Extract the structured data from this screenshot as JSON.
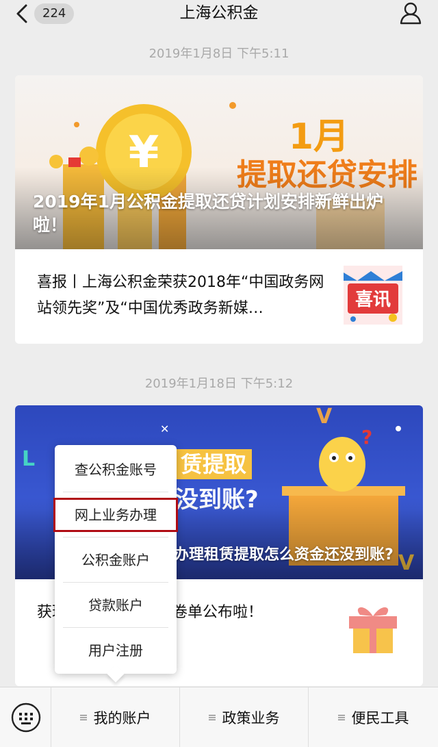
{
  "header": {
    "back_count": "224",
    "title": "上海公积金"
  },
  "messages": [
    {
      "timestamp": "2019年1月8日 下午5:11",
      "banner": {
        "art_text_line1": "1月",
        "art_text_line2": "提取还贷安排",
        "title": "2019年1月公积金提取还贷计划安排新鲜出炉啦！"
      },
      "sub_item": {
        "text": "喜报丨上海公积金荣获2018年“中国政务网站领先奖”及“中国优秀政务新媒…",
        "thumb_text": "喜讯"
      }
    },
    {
      "timestamp": "2019年1月18日 下午5:12",
      "banner": {
        "art_text_line1": "赁提取",
        "art_text_line2": "没到账?",
        "title": "办理租赁提取怎么资金还没到账?"
      },
      "sub_item": {
        "text": "获理个人租赁提取问卷单公布啦！"
      }
    }
  ],
  "popup_menu": {
    "items": [
      "查公积金账号",
      "网上业务办理",
      "公积金账户",
      "贷款账户",
      "用户注册"
    ],
    "highlight_color": "#b00c14"
  },
  "bottom_menu": {
    "keyboard_icon": "keyboard-icon",
    "tabs": [
      "我的账户",
      "政策业务",
      "便民工具"
    ]
  }
}
